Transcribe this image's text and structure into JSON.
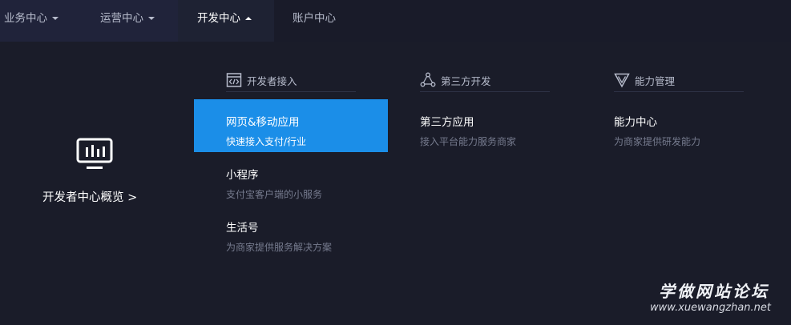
{
  "nav": {
    "items": [
      {
        "label": "业务中心",
        "has_caret": true
      },
      {
        "label": "运营中心",
        "has_caret": true
      },
      {
        "label": "开发中心",
        "has_caret": true,
        "active": true
      },
      {
        "label": "账户中心",
        "has_caret": false
      }
    ]
  },
  "overview": {
    "icon": "chart-monitor-icon",
    "label": "开发者中心概览 >"
  },
  "columns": [
    {
      "header": "开发者接入",
      "icon": "code-window-icon",
      "items": [
        {
          "title": "网页&移动应用",
          "desc": "快速接入支付/行业",
          "highlighted": true
        },
        {
          "title": "小程序",
          "desc": "支付宝客户端的小服务"
        },
        {
          "title": "生活号",
          "desc": "为商家提供服务解决方案"
        }
      ]
    },
    {
      "header": "第三方开发",
      "icon": "network-nodes-icon",
      "items": [
        {
          "title": "第三方应用",
          "desc": "接入平台能力服务商家"
        }
      ]
    },
    {
      "header": "能力管理",
      "icon": "triangle-shield-icon",
      "items": [
        {
          "title": "能力中心",
          "desc": "为商家提供研发能力"
        }
      ]
    }
  ],
  "watermark": {
    "title": "学做网站论坛",
    "url": "www.xuewangzhan.net"
  },
  "colors": {
    "background": "#1a1c29",
    "highlight": "#1b8ee8",
    "muted_text": "#767b8e"
  }
}
